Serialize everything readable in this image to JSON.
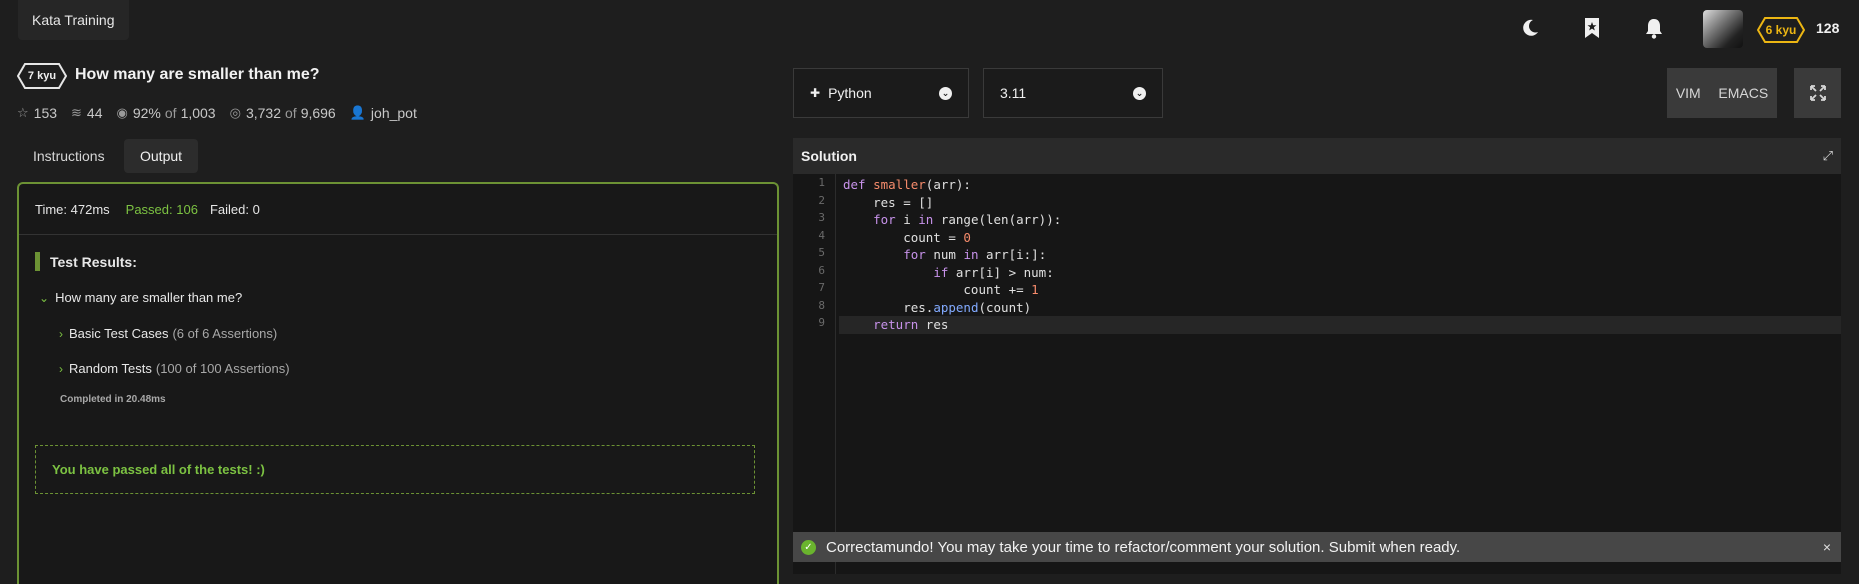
{
  "header": {
    "brand_label": "Kata Training",
    "icons": [
      "moon-icon",
      "bookmark-star-icon",
      "bell-icon"
    ],
    "rank_label": "6 kyu",
    "rank_color": "#ecb613",
    "honor": "128"
  },
  "kata": {
    "kyu_label": "7 kyu",
    "title": "How many are smaller than me?",
    "stats": {
      "stars": "153",
      "collections": "44",
      "satisfaction_pct": "92%",
      "satisfaction_of": "of",
      "satisfaction_total": "1,003",
      "completed": "3,732",
      "completed_of": "of",
      "completed_total": "9,696",
      "author": "joh_pot"
    }
  },
  "tabs": [
    {
      "label": "Instructions",
      "active": false
    },
    {
      "label": "Output",
      "active": true
    }
  ],
  "output": {
    "time_label": "Time: 472ms",
    "passed_label": "Passed: 106",
    "failed_label": "Failed: 0",
    "results_heading": "Test Results:",
    "group_label": "How many are smaller than me?",
    "cases": [
      {
        "name": "Basic Test Cases",
        "detail": "(6 of 6 Assertions)"
      },
      {
        "name": "Random Tests",
        "detail": "(100 of 100 Assertions)"
      }
    ],
    "completed_label": "Completed in 20.48ms",
    "pass_message": "You have passed all of the tests! :)",
    "accent_color": "#6c9234",
    "pass_color": "#7cc242"
  },
  "language": {
    "selected": "Python"
  },
  "version": {
    "selected": "3.11"
  },
  "editor_modes": [
    "VIM",
    "EMACS"
  ],
  "solution": {
    "title": "Solution",
    "lines": [
      "def smaller(arr):",
      "    res = []",
      "    for i in range(len(arr)):",
      "        count = 0",
      "        for num in arr[i:]:",
      "            if arr[i] > num:",
      "                count += 1",
      "        res.append(count)",
      "    return res"
    ],
    "line_numbers": [
      "1",
      "2",
      "3",
      "4",
      "5",
      "6",
      "7",
      "8",
      "9"
    ],
    "current_line": 9
  },
  "toast": {
    "message": "Correctamundo! You may take your time to refactor/comment your solution. Submit when ready.",
    "close": "×"
  }
}
